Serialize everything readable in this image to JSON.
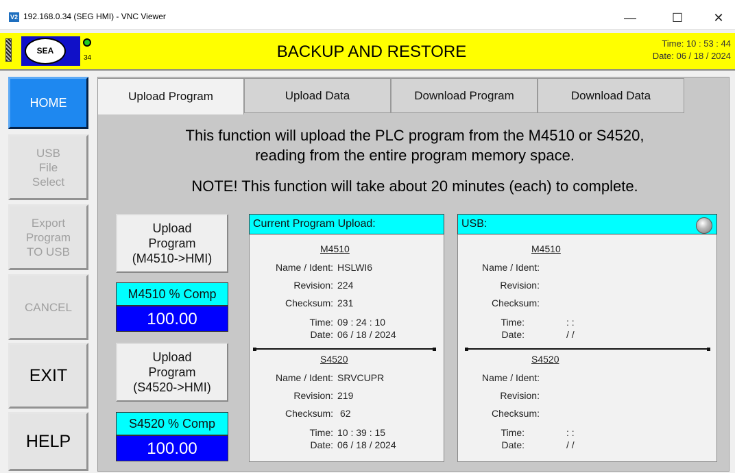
{
  "window": {
    "title": "192.168.0.34 (SEG HMI) - VNC Viewer",
    "app_icon_label": "V2",
    "minimize": "—",
    "maximize": "☐",
    "close": "✕"
  },
  "header": {
    "logo_text": "SEA",
    "station_number": "34",
    "title": "BACKUP AND RESTORE",
    "time": "Time: 10 : 53 : 44",
    "date": "Date: 06 / 18 / 2024",
    "status_led_color": "#22cc22"
  },
  "nav": [
    {
      "label": "HOME",
      "state": "active"
    },
    {
      "label": "USB\nFile\nSelect",
      "state": "disabled"
    },
    {
      "label": "Export\nProgram\nTO USB",
      "state": "disabled"
    },
    {
      "label": "CANCEL",
      "state": "disabled"
    },
    {
      "label": "EXIT",
      "state": "enabled"
    },
    {
      "label": "HELP",
      "state": "enabled"
    }
  ],
  "tabs": [
    {
      "label": "Upload Program",
      "active": true
    },
    {
      "label": "Upload Data",
      "active": false
    },
    {
      "label": "Download Program",
      "active": false
    },
    {
      "label": "Download Data",
      "active": false
    }
  ],
  "message": {
    "line1": "This function will upload the PLC program from the M4510 or S4520,",
    "line2": "reading from the entire program memory space.",
    "note": "NOTE! This function will take about 20 minutes (each) to complete."
  },
  "upload_m4510": {
    "label": "Upload\nProgram\n(M4510->HMI)",
    "comp_label": "M4510 % Comp",
    "comp_value": "100.00"
  },
  "upload_s4520": {
    "label": "Upload\nProgram\n(S4520->HMI)",
    "comp_label": "S4520 % Comp",
    "comp_value": "100.00"
  },
  "labels": {
    "name": "Name / Ident:",
    "revision": "Revision:",
    "checksum": "Checksum:",
    "time": "Time:",
    "date": "Date:"
  },
  "current_panel": {
    "title": "Current Program Upload:",
    "m4510": {
      "heading": "M4510",
      "name": "HSLWI6",
      "revision": "224",
      "checksum": "231",
      "time": "09 : 24 : 10",
      "date": "06 / 18 / 2024"
    },
    "s4520": {
      "heading": "S4520",
      "name": "SRVCUPR",
      "revision": "219",
      "checksum": "62",
      "time": "10 : 39 : 15",
      "date": "06 / 18 / 2024"
    }
  },
  "usb_panel": {
    "title": "USB:",
    "m4510": {
      "heading": "M4510",
      "time": ":     :",
      "date": "/     /"
    },
    "s4520": {
      "heading": "S4520",
      "time": ":     :",
      "date": "/     /"
    }
  },
  "colors": {
    "header_bg": "#ffff00",
    "nav_active": "#1e88f0",
    "cyan": "#00ffff",
    "comp_blue": "#0000ff"
  }
}
